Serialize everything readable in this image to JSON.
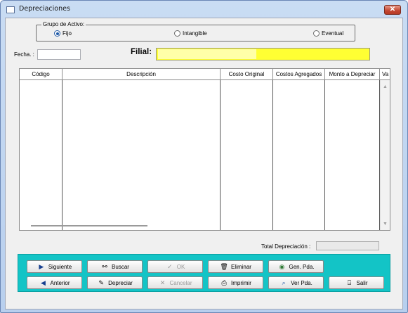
{
  "window": {
    "title": "Depreciaciones",
    "close_glyph": "✕"
  },
  "group": {
    "legend": "Grupo de Activo:",
    "options": [
      {
        "label": "Fijo",
        "selected": true
      },
      {
        "label": "Intangible",
        "selected": false
      },
      {
        "label": "Eventual",
        "selected": false
      }
    ]
  },
  "fecha": {
    "label": "Fecha. :",
    "value": ""
  },
  "filial": {
    "label": "Filial:",
    "value": "",
    "color": "#ffff33"
  },
  "table": {
    "columns": [
      "Código",
      "Descripción",
      "Costo Original",
      "Costos Agregados",
      "Monto a Depreciar",
      "Va"
    ],
    "rows": []
  },
  "total": {
    "label": "Total Depreciación :",
    "value": ""
  },
  "buttons": {
    "siguiente": "Siguiente",
    "buscar": "Buscar",
    "ok": "OK",
    "eliminar": "Eliminar",
    "gen_pda": "Gen. Pda.",
    "anterior": "Anterior",
    "depreciar": "Depreciar",
    "cancelar": "Cancelar",
    "imprimir": "Imprimir",
    "ver_pda": "Ver Pda.",
    "salir": "Salir"
  },
  "icons": {
    "siguiente": "play-right-icon",
    "buscar": "binoculars-icon",
    "ok": "checkmark-icon",
    "eliminar": "trash-icon",
    "gen_pda": "globe-icon",
    "anterior": "play-left-icon",
    "depreciar": "pencil-icon",
    "cancelar": "x-icon",
    "imprimir": "printer-icon",
    "ver_pda": "magnifier-icon",
    "salir": "exit-door-icon"
  },
  "colors": {
    "button_bar": "#13c4c6",
    "window_frame": "#b8cfee"
  }
}
